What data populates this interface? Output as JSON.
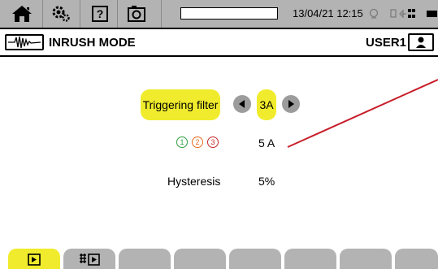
{
  "statusbar": {
    "datetime": "13/04/21 12:15",
    "icons": [
      "home-icon",
      "settings-icon",
      "help-icon",
      "camera-icon",
      "recording-icon",
      "usb-icon",
      "network-icon",
      "battery-icon"
    ]
  },
  "titlebar": {
    "mode_icon": "inrush-waveform-icon",
    "title": "INRUSH MODE",
    "user": "USER1",
    "user_icon": "user-lock-icon"
  },
  "settings": {
    "triggering_filter": {
      "label": "Triggering filter",
      "value": "3A"
    },
    "current": {
      "phases": [
        "1",
        "2",
        "3"
      ],
      "value": "5 A"
    },
    "hysteresis": {
      "label": "Hysteresis",
      "value": "5%"
    }
  },
  "colors": {
    "accent": "#f0ec2d",
    "bar_gray": "#b3b3b3",
    "phase1": "#2e9e3e",
    "phase2": "#e86a1c",
    "phase3": "#c62828",
    "annotation": "#c81e2a"
  },
  "tabs": [
    {
      "icon": "play-icon",
      "active": true
    },
    {
      "icon": "capture-play-icon",
      "active": false
    }
  ]
}
